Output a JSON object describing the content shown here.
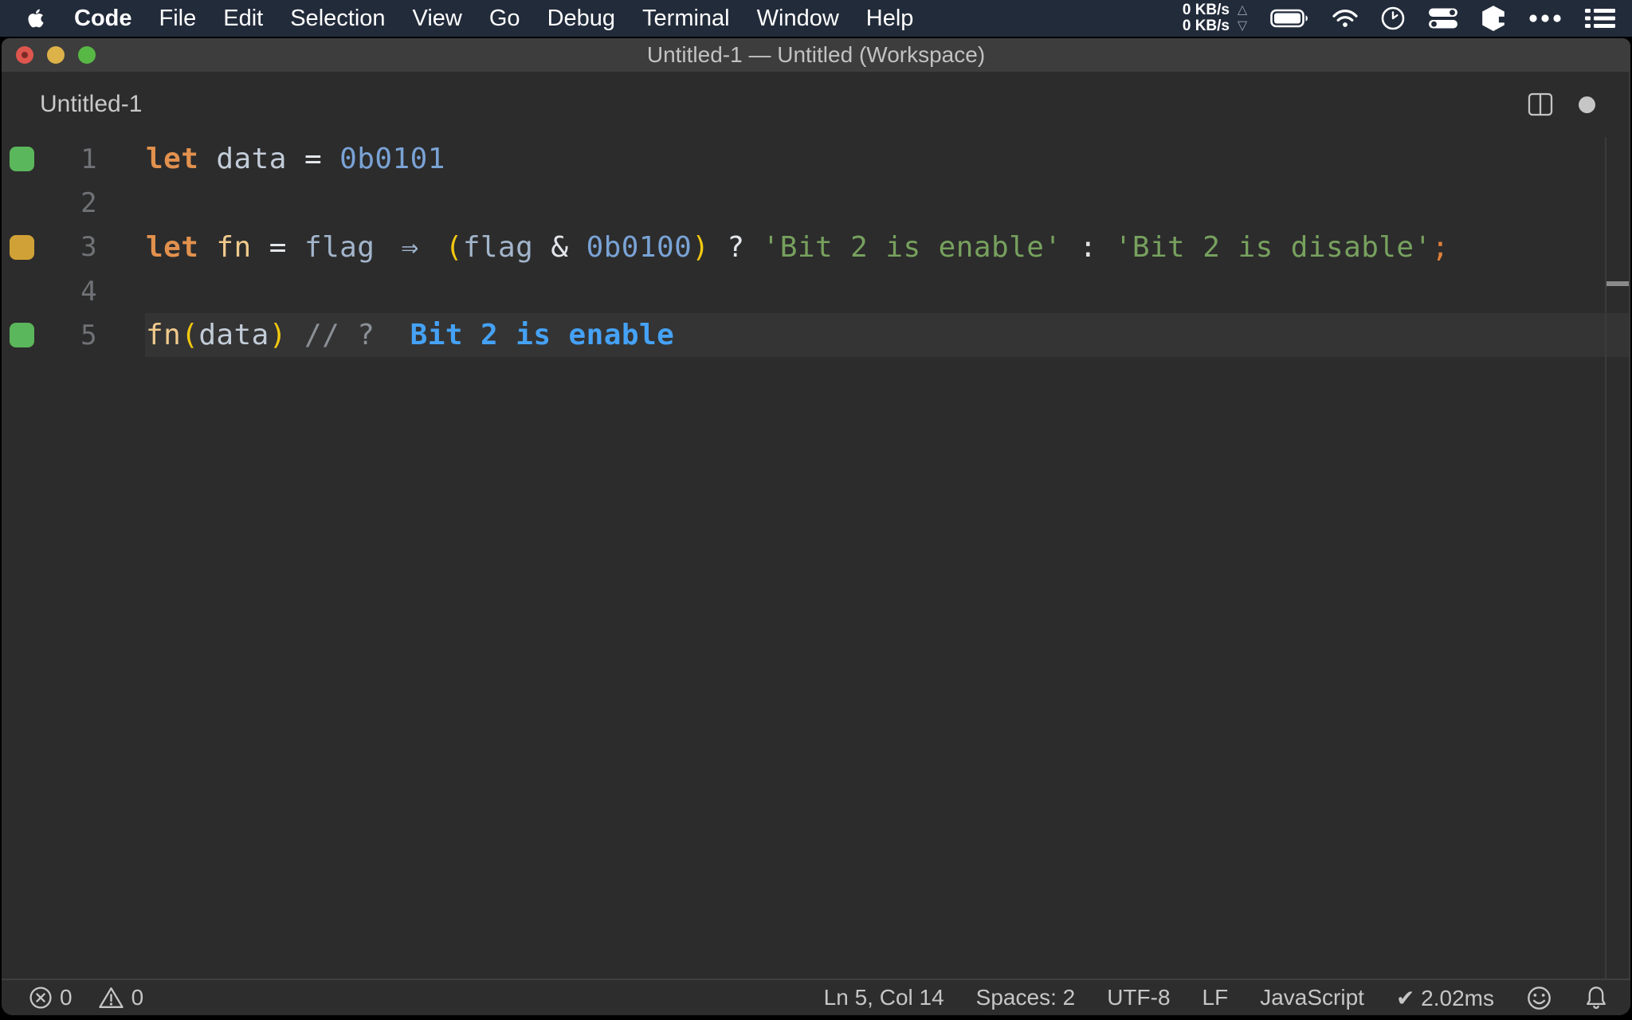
{
  "menubar": {
    "apple_icon": "apple-logo",
    "items": [
      {
        "label": "Code",
        "bold": true
      },
      {
        "label": "File"
      },
      {
        "label": "Edit"
      },
      {
        "label": "Selection"
      },
      {
        "label": "View"
      },
      {
        "label": "Go"
      },
      {
        "label": "Debug"
      },
      {
        "label": "Terminal"
      },
      {
        "label": "Window"
      },
      {
        "label": "Help"
      }
    ],
    "network": {
      "up_value": "0 KB/s",
      "up_symbol": "△",
      "down_value": "0 KB/s",
      "down_symbol": "▽"
    },
    "tray_icons": [
      "battery-icon",
      "wifi-icon",
      "clock-icon",
      "control-center-icon",
      "cube-icon",
      "ellipsis-icon",
      "list-icon"
    ]
  },
  "titlebar": {
    "title": "Untitled-1 — Untitled (Workspace)"
  },
  "tabbar": {
    "tab_label": "Untitled-1",
    "icons": [
      "split-editor-icon",
      "unsaved-dot"
    ]
  },
  "editor": {
    "language": "JavaScript",
    "lines": [
      {
        "number": "1",
        "marker": "green",
        "current": false,
        "tokens": [
          {
            "c": "kw",
            "t": "let"
          },
          {
            "c": "plain",
            "t": " "
          },
          {
            "c": "var",
            "t": "data"
          },
          {
            "c": "plain",
            "t": " "
          },
          {
            "c": "op",
            "t": "="
          },
          {
            "c": "plain",
            "t": " "
          },
          {
            "c": "num",
            "t": "0b0101"
          }
        ]
      },
      {
        "number": "2",
        "marker": null,
        "current": false,
        "tokens": []
      },
      {
        "number": "3",
        "marker": "orange",
        "current": false,
        "tokens": [
          {
            "c": "kw",
            "t": "let"
          },
          {
            "c": "plain",
            "t": " "
          },
          {
            "c": "fn",
            "t": "fn"
          },
          {
            "c": "plain",
            "t": " "
          },
          {
            "c": "op",
            "t": "="
          },
          {
            "c": "plain",
            "t": " "
          },
          {
            "c": "param",
            "t": "flag"
          },
          {
            "c": "plain",
            "t": " "
          },
          {
            "c": "arrow",
            "t": "⇒"
          },
          {
            "c": "plain",
            "t": " "
          },
          {
            "c": "paren",
            "t": "("
          },
          {
            "c": "param",
            "t": "flag"
          },
          {
            "c": "plain",
            "t": " "
          },
          {
            "c": "op",
            "t": "&"
          },
          {
            "c": "plain",
            "t": " "
          },
          {
            "c": "num",
            "t": "0b0100"
          },
          {
            "c": "paren",
            "t": ")"
          },
          {
            "c": "plain",
            "t": " "
          },
          {
            "c": "op",
            "t": "?"
          },
          {
            "c": "plain",
            "t": " "
          },
          {
            "c": "str",
            "t": "'Bit 2 is enable'"
          },
          {
            "c": "plain",
            "t": " "
          },
          {
            "c": "op",
            "t": ":"
          },
          {
            "c": "plain",
            "t": " "
          },
          {
            "c": "str",
            "t": "'Bit 2 is disable'"
          },
          {
            "c": "semi",
            "t": ";"
          }
        ]
      },
      {
        "number": "4",
        "marker": null,
        "current": false,
        "tokens": []
      },
      {
        "number": "5",
        "marker": "green",
        "current": true,
        "tokens": [
          {
            "c": "fn",
            "t": "fn"
          },
          {
            "c": "paren",
            "t": "("
          },
          {
            "c": "var",
            "t": "data"
          },
          {
            "c": "paren",
            "t": ")"
          },
          {
            "c": "plain",
            "t": " "
          },
          {
            "c": "comment",
            "t": "// ?"
          },
          {
            "c": "plain",
            "t": "  "
          },
          {
            "c": "quokka",
            "t": "Bit 2 is enable"
          }
        ]
      }
    ]
  },
  "status_bar": {
    "errors": "0",
    "warnings": "0",
    "items": [
      {
        "name": "cursor-position",
        "label": "Ln 5, Col 14"
      },
      {
        "name": "indentation",
        "label": "Spaces: 2"
      },
      {
        "name": "encoding",
        "label": "UTF-8"
      },
      {
        "name": "eol",
        "label": "LF"
      },
      {
        "name": "language-mode",
        "label": "JavaScript"
      },
      {
        "name": "quokka-run-time",
        "label": "✔ 2.02ms"
      }
    ],
    "right_icons": [
      "feedback-smiley-icon",
      "notifications-bell-icon"
    ]
  },
  "colors": {
    "menubar_bg": "#222b3a",
    "titlebar_bg": "#3d3d3d",
    "editor_bg": "#2c2c2c",
    "current_line_bg": "#343434",
    "marker_green": "#5bb75b",
    "marker_orange": "#d0a136",
    "keyword_orange": "#e2914e",
    "number_blue": "#7aa3d6",
    "string_green": "#77a15e",
    "quokka_value_blue": "#45a2f6"
  }
}
